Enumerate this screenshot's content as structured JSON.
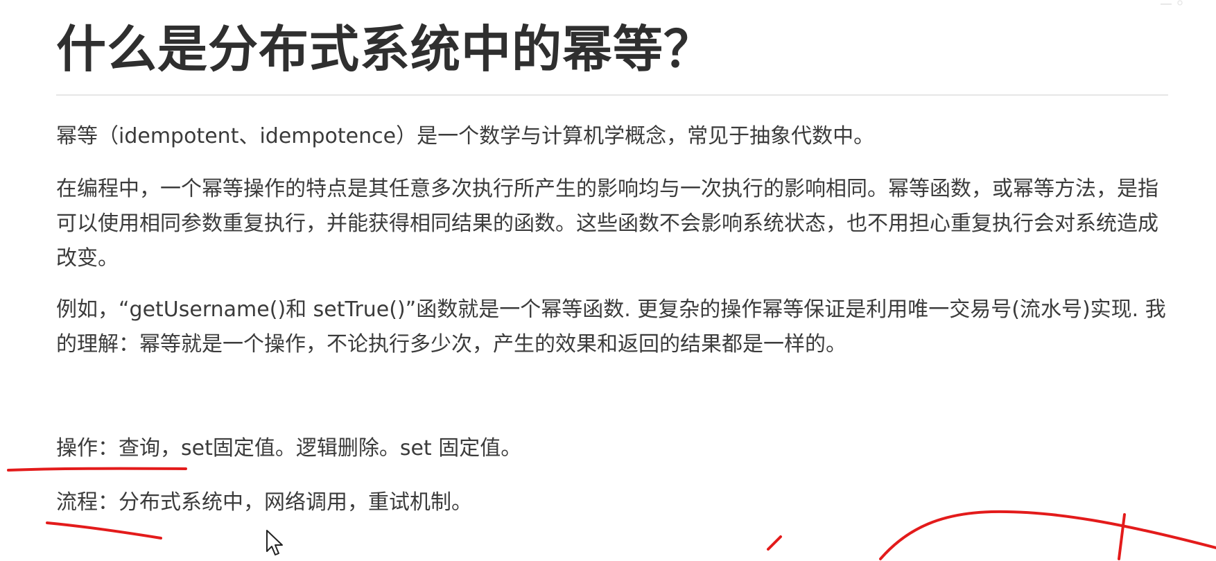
{
  "article": {
    "title": "什么是分布式系统中的幂等？",
    "paragraphs": [
      "幂等（idempotent、idempotence）是一个数学与计算机学概念，常见于抽象代数中。",
      "在编程中，一个幂等操作的特点是其任意多次执行所产生的影响均与一次执行的影响相同。幂等函数，或幂等方法，是指可以使用相同参数重复执行，并能获得相同结果的函数。这些函数不会影响系统状态，也不用担心重复执行会对系统造成改变。",
      "例如，“getUsername()和 setTrue()”函数就是一个幂等函数. 更复杂的操作幂等保证是利用唯一交易号(流水号)实现. 我的理解：幂等就是一个操作，不论执行多少次，产生的效果和返回的结果都是一样的。",
      "操作：查询，set固定值。逻辑删除。set 固定值。",
      "流程：分布式系统中，网络调用，重试机制。"
    ]
  },
  "annotation": {
    "ink_color": "#e31b1b"
  },
  "icons": {
    "cursor": "mouse-pointer-icon"
  }
}
